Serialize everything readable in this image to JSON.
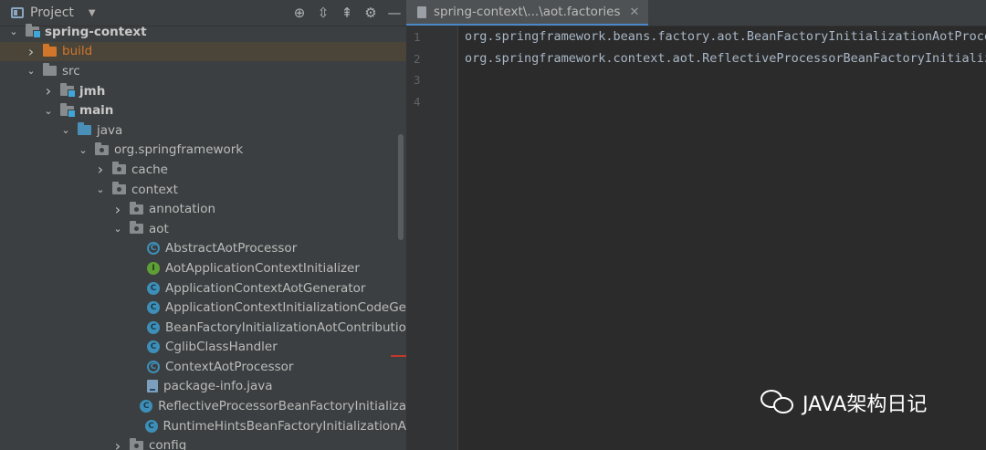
{
  "project_panel": {
    "title": "Project",
    "tools": [
      "locate-icon",
      "expand-all-icon",
      "collapse-all-icon",
      "gear-icon",
      "minimize-icon"
    ]
  },
  "tree": [
    {
      "label": "spring-context",
      "depth": 1,
      "arrow": "open",
      "icon": "module-folder",
      "style": "bold"
    },
    {
      "label": "build",
      "depth": 2,
      "arrow": "closed",
      "icon": "orange-folder",
      "style": "orange",
      "selected": true
    },
    {
      "label": "src",
      "depth": 2,
      "arrow": "open",
      "icon": "folder"
    },
    {
      "label": "jmh",
      "depth": 3,
      "arrow": "closed",
      "icon": "module-folder",
      "style": "bold"
    },
    {
      "label": "main",
      "depth": 3,
      "arrow": "open",
      "icon": "module-folder",
      "style": "bold"
    },
    {
      "label": "java",
      "depth": 4,
      "arrow": "open",
      "icon": "blue-folder"
    },
    {
      "label": "org.springframework",
      "depth": 5,
      "arrow": "open",
      "icon": "package-folder"
    },
    {
      "label": "cache",
      "depth": 6,
      "arrow": "closed",
      "icon": "package-folder"
    },
    {
      "label": "context",
      "depth": 6,
      "arrow": "open",
      "icon": "package-folder"
    },
    {
      "label": "annotation",
      "depth": 7,
      "arrow": "closed",
      "icon": "package-folder"
    },
    {
      "label": "aot",
      "depth": 7,
      "arrow": "open",
      "icon": "package-folder"
    },
    {
      "label": "AbstractAotProcessor",
      "depth": 8,
      "arrow": "none",
      "icon": "abstract-class"
    },
    {
      "label": "AotApplicationContextInitializer",
      "depth": 8,
      "arrow": "none",
      "icon": "interface"
    },
    {
      "label": "ApplicationContextAotGenerator",
      "depth": 8,
      "arrow": "none",
      "icon": "class"
    },
    {
      "label": "ApplicationContextInitializationCodeGe",
      "depth": 8,
      "arrow": "none",
      "icon": "class"
    },
    {
      "label": "BeanFactoryInitializationAotContributio",
      "depth": 8,
      "arrow": "none",
      "icon": "class"
    },
    {
      "label": "CglibClassHandler",
      "depth": 8,
      "arrow": "none",
      "icon": "class"
    },
    {
      "label": "ContextAotProcessor",
      "depth": 8,
      "arrow": "none",
      "icon": "abstract-class"
    },
    {
      "label": "package-info.java",
      "depth": 8,
      "arrow": "none",
      "icon": "java-file"
    },
    {
      "label": "ReflectiveProcessorBeanFactoryInitializa",
      "depth": 8,
      "arrow": "none",
      "icon": "class"
    },
    {
      "label": "RuntimeHintsBeanFactoryInitializationA",
      "depth": 8,
      "arrow": "none",
      "icon": "class"
    },
    {
      "label": "config",
      "depth": 7,
      "arrow": "closed",
      "icon": "package-folder"
    }
  ],
  "editor": {
    "tab_label": "spring-context\\...\\aot.factories",
    "line_numbers": [
      "1",
      "2",
      "3",
      "4"
    ],
    "lines": [
      "org.springframework.beans.factory.aot.BeanFactoryInitializationAotProcessor",
      "org.springframework.context.aot.ReflectiveProcessorBeanFactoryInitializationAotProcessor",
      "",
      ""
    ]
  },
  "watermark": {
    "text": "JAVA架构日记",
    "icon": "wechat-icon"
  },
  "colors": {
    "background": "#2b2b2b",
    "panel": "#3c3f41",
    "selection": "#4a4538",
    "accent": "#4a88c7"
  }
}
